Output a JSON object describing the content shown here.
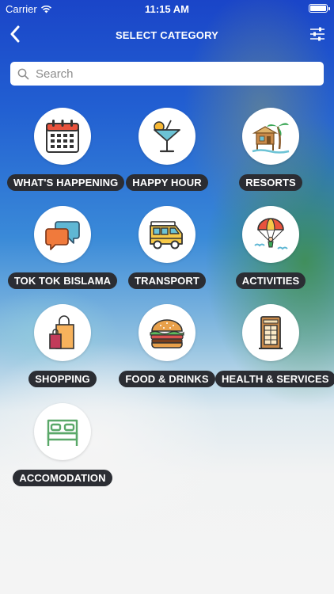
{
  "status_bar": {
    "carrier": "Carrier",
    "time": "11:15 AM",
    "battery_level": 1.0
  },
  "header": {
    "title": "SELECT CATEGORY",
    "back_icon": "chevron-left-icon",
    "filter_icon": "sliders-icon"
  },
  "search": {
    "placeholder": "Search",
    "value": ""
  },
  "categories": [
    {
      "label": "WHAT'S HAPPENING",
      "icon": "calendar-icon"
    },
    {
      "label": "HAPPY HOUR",
      "icon": "cocktail-icon"
    },
    {
      "label": "RESORTS",
      "icon": "beach-hut-icon"
    },
    {
      "label": "TOK TOK BISLAMA",
      "icon": "speech-bubbles-icon"
    },
    {
      "label": "TRANSPORT",
      "icon": "van-icon"
    },
    {
      "label": "ACTIVITIES",
      "icon": "parachute-icon"
    },
    {
      "label": "SHOPPING",
      "icon": "shopping-bags-icon"
    },
    {
      "label": "FOOD & DRINKS",
      "icon": "burger-icon"
    },
    {
      "label": "HEALTH & SERVICES",
      "icon": "phone-booth-icon"
    },
    {
      "label": "ACCOMODATION",
      "icon": "bed-icon"
    }
  ]
}
